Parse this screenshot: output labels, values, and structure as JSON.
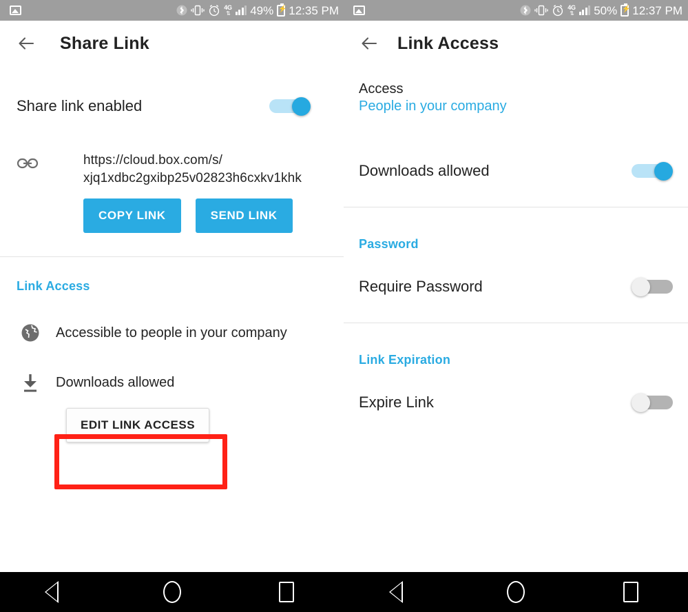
{
  "status_bar": {
    "left": {
      "notification_icon": "photo-icon",
      "icons": [
        "bluetooth-icon",
        "vibrate-icon",
        "alarm-icon",
        "lte-4g-icon",
        "signal-icon"
      ],
      "battery_percent": "49%",
      "battery_icon": "battery-charging-icon",
      "time": "12:35 PM"
    },
    "right": {
      "notification_icon": "photo-icon",
      "icons": [
        "bluetooth-icon",
        "vibrate-icon",
        "alarm-icon",
        "lte-4g-icon",
        "signal-icon"
      ],
      "battery_percent": "50%",
      "battery_icon": "battery-charging-icon",
      "time": "12:37 PM"
    }
  },
  "colors": {
    "accent_blue": "#2aabe2",
    "toggle_on_track": "#b9e3f7",
    "toggle_off_track": "#b3b3b3",
    "highlight_red": "#ff2116",
    "status_bar_gray": "#9e9e9e",
    "text_primary": "#232323"
  },
  "left_panel": {
    "back_icon": "back-arrow-icon",
    "title": "Share Link",
    "share_link_enabled": {
      "label": "Share link enabled",
      "toggle_state": "on"
    },
    "link": {
      "icon": "chain-link-icon",
      "url_line_1": "https://cloud.box.com/s/",
      "url_line_2": "xjq1xdbc2gxibp25v02823h6cxkv1khk",
      "copy_button": "COPY LINK",
      "send_button": "SEND LINK"
    },
    "link_access_section": {
      "header": "Link Access",
      "rows": [
        {
          "icon": "globe-icon",
          "label": "Accessible to people in your company"
        },
        {
          "icon": "download-icon",
          "label": "Downloads allowed"
        }
      ],
      "edit_button": "EDIT LINK ACCESS"
    }
  },
  "right_panel": {
    "back_icon": "back-arrow-icon",
    "title": "Link Access",
    "access": {
      "label": "Access",
      "value": "People in your company"
    },
    "downloads": {
      "label": "Downloads allowed",
      "toggle_state": "on"
    },
    "password_section": {
      "header": "Password",
      "require_password": {
        "label": "Require Password",
        "toggle_state": "off"
      }
    },
    "expiration_section": {
      "header": "Link Expiration",
      "expire_link": {
        "label": "Expire Link",
        "toggle_state": "off"
      }
    }
  },
  "nav_bar": {
    "buttons": [
      "back-nav-icon",
      "home-nav-icon",
      "recents-nav-icon"
    ]
  }
}
